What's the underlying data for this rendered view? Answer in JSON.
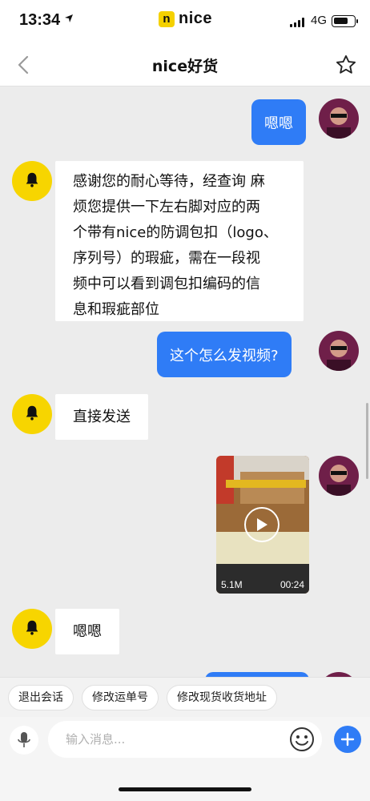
{
  "status_bar": {
    "time": "13:34",
    "network": "4G",
    "logo_letter": "n",
    "logo_text": "nice",
    "battery_level": 0.75
  },
  "nav": {
    "title": "nice好货"
  },
  "messages": [
    {
      "side": "right",
      "text": "嗯嗯"
    },
    {
      "side": "left",
      "lines": [
        "感谢您的耐心等待，经查询 麻",
        "烦您提供一下左右脚对应的两",
        "个带有nice的防调包扣（logo、",
        "序列号）的瑕疵，需在一段视",
        "频中可以看到调包扣编码的信",
        "息和瑕疵部位"
      ]
    },
    {
      "side": "right",
      "text": "这个怎么发视频?"
    },
    {
      "side": "left",
      "text": "直接发送"
    },
    {
      "side": "right",
      "video": {
        "size": "5.1M",
        "duration": "00:24"
      }
    },
    {
      "side": "left",
      "text": "嗯嗯"
    }
  ],
  "quick_replies": [
    "退出会话",
    "修改运单号",
    "修改现货收货地址"
  ],
  "input": {
    "placeholder": "输入消息..."
  },
  "colors": {
    "accent_blue": "#2f7cf6",
    "bot_yellow": "#f7d500",
    "chat_bg": "#ececec"
  },
  "icons": [
    "back-arrow-icon",
    "star-icon",
    "bell-icon",
    "play-icon",
    "microphone-icon",
    "emoji-icon",
    "plus-icon",
    "location-arrow-icon"
  ]
}
